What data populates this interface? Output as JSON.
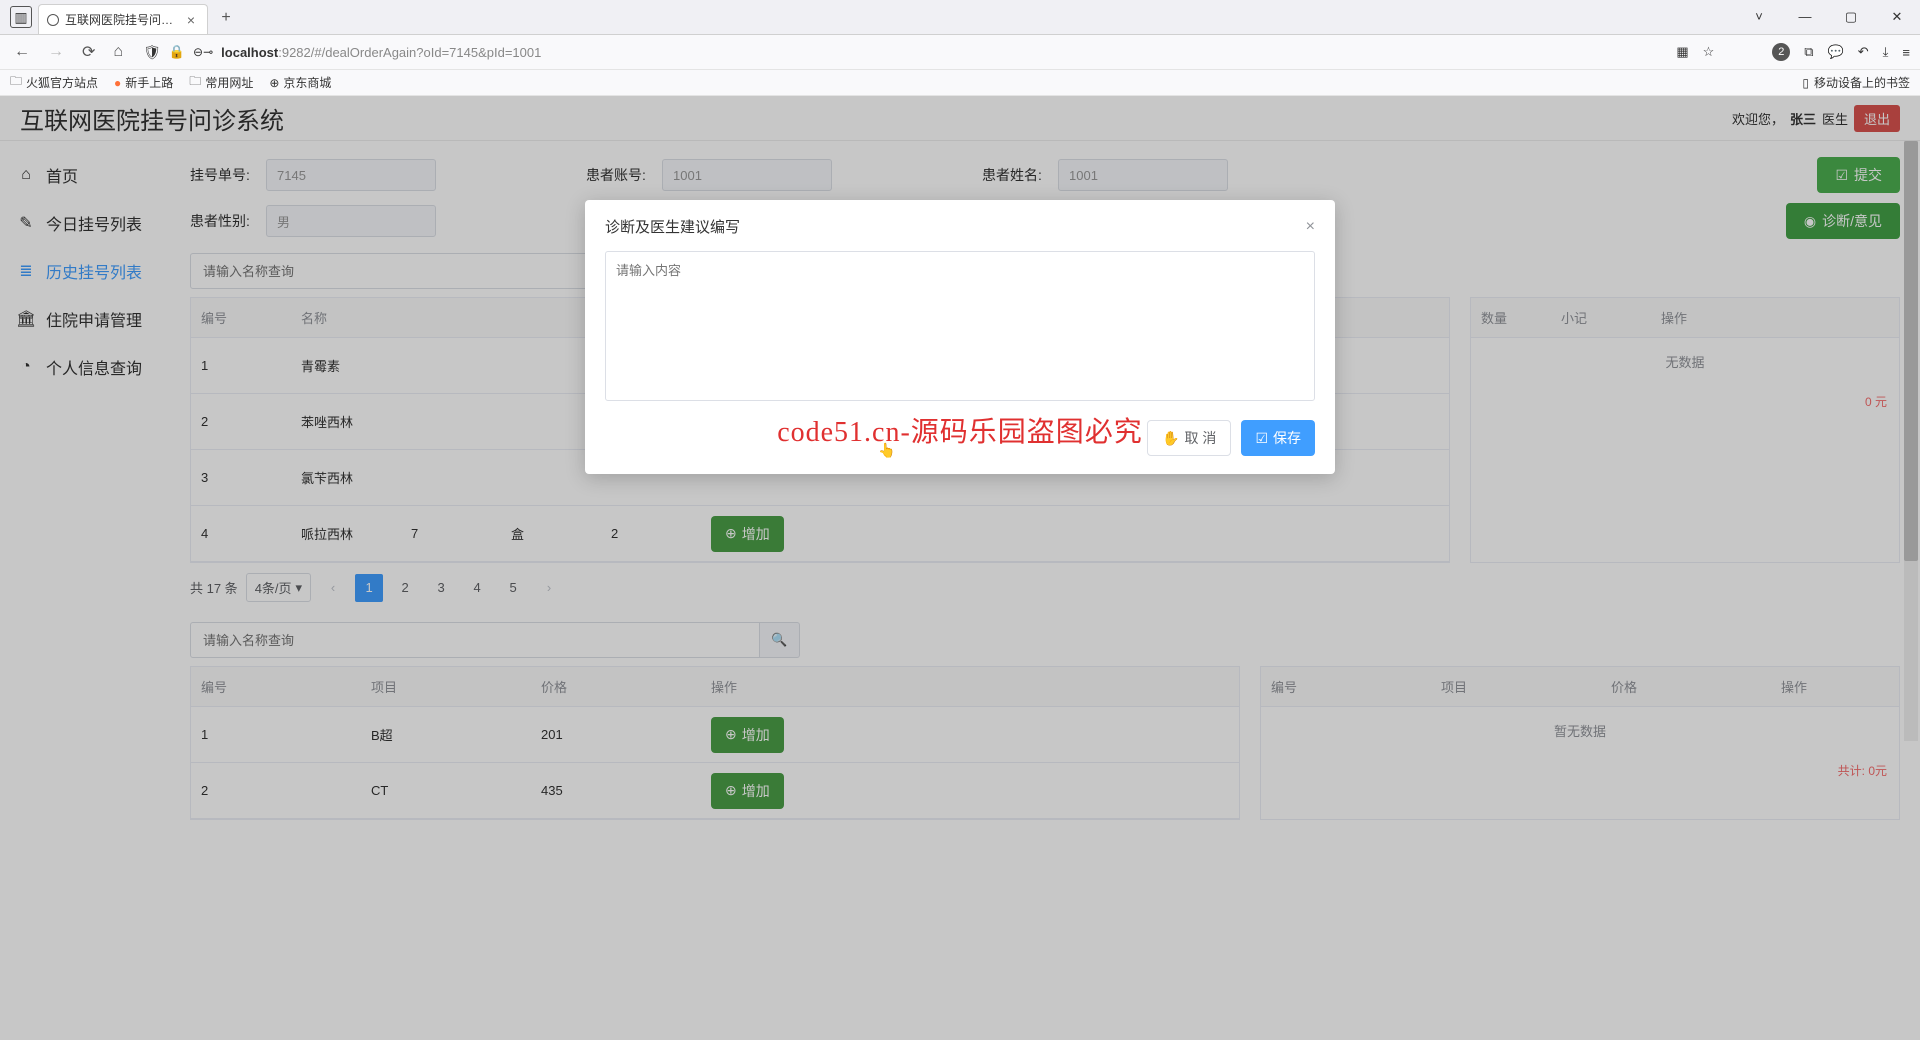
{
  "browser": {
    "tab_title": "互联网医院挂号问诊系统",
    "url_prefix": "localhost",
    "url_suffix": ":9282/#/dealOrderAgain?oId=7145&pId=1001",
    "bookmarks": [
      "火狐官方站点",
      "新手上路",
      "常用网址",
      "京东商城"
    ],
    "mobile_bk": "移动设备上的书签",
    "badge": "2"
  },
  "app": {
    "title": "互联网医院挂号问诊系统",
    "welcome": "欢迎您，",
    "user": "张三",
    "role": "医生",
    "logout": "退出"
  },
  "sidebar": {
    "items": [
      {
        "icon": "⌂",
        "label": "首页"
      },
      {
        "icon": "✎",
        "label": "今日挂号列表"
      },
      {
        "icon": "≣",
        "label": "历史挂号列表"
      },
      {
        "icon": "🏛",
        "label": "住院申请管理"
      },
      {
        "icon": "◔",
        "label": "个人信息查询"
      }
    ]
  },
  "form": {
    "f1_label": "挂号单号:",
    "f1_val": "7145",
    "f2_label": "患者账号:",
    "f2_val": "1001",
    "f3_label": "患者姓名:",
    "f3_val": "1001",
    "f4_label": "患者性别:",
    "f4_val": "男",
    "btn_submit": "提交",
    "btn_diag": "诊断/意见"
  },
  "search": {
    "placeholder": "请输入名称查询"
  },
  "table1": {
    "heads": [
      "编号",
      "名称"
    ],
    "rows": [
      {
        "id": "1",
        "name": "青霉素"
      },
      {
        "id": "2",
        "name": "苯唑西林"
      },
      {
        "id": "3",
        "name": "氯苄西林"
      },
      {
        "id": "4",
        "name": "哌拉西林",
        "c3": "7",
        "c4": "盒",
        "c5": "2",
        "btn": "增加"
      }
    ],
    "rheads": [
      "数量",
      "小记",
      "操作"
    ],
    "rnodata": "无数据",
    "rsum": "0 元"
  },
  "pager": {
    "total": "共 17 条",
    "per": "4条/页",
    "pages": [
      "1",
      "2",
      "3",
      "4",
      "5"
    ]
  },
  "search2": {
    "placeholder": "请输入名称查询"
  },
  "table2": {
    "lheads": [
      "编号",
      "项目",
      "价格",
      "操作"
    ],
    "lrows": [
      {
        "id": "1",
        "name": "B超",
        "price": "201",
        "btn": "增加"
      },
      {
        "id": "2",
        "name": "CT",
        "price": "435",
        "btn": "增加"
      }
    ],
    "rheads": [
      "编号",
      "项目",
      "价格",
      "操作"
    ],
    "rnodata": "暂无数据",
    "rsum": "共计: 0元"
  },
  "modal": {
    "title": "诊断及医生建议编写",
    "placeholder": "请输入内容",
    "cancel": "取 消",
    "save": "保存"
  },
  "wm": "code51.cn-源码乐园盗图必究"
}
